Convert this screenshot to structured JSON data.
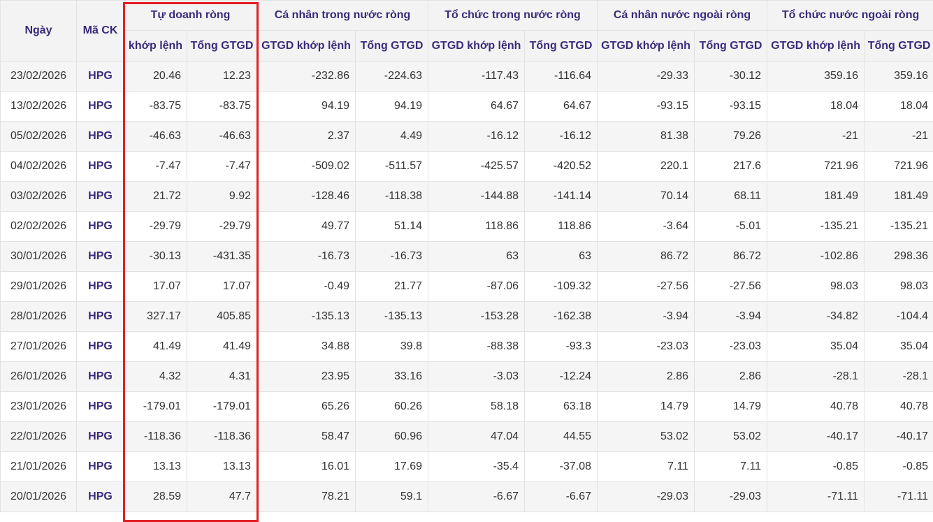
{
  "table": {
    "headers": {
      "date": "Ngày",
      "ticker": "Mã CK",
      "groups": [
        "Tự doanh ròng",
        "Cá nhân trong nước ròng",
        "Tổ chức trong nước ròng",
        "Cá nhân nước ngoài ròng",
        "Tổ chức nước ngoài ròng"
      ],
      "sub_first": [
        "khớp lệnh",
        "Tổng GTGD"
      ],
      "sub_other": [
        "GTGD khớp lệnh",
        "Tổng GTGD"
      ]
    },
    "rows": [
      {
        "date": "23/02/2026",
        "ticker": "HPG",
        "values": [
          "20.46",
          "12.23",
          "-232.86",
          "-224.63",
          "-117.43",
          "-116.64",
          "-29.33",
          "-30.12",
          "359.16",
          "359.16"
        ]
      },
      {
        "date": "13/02/2026",
        "ticker": "HPG",
        "values": [
          "-83.75",
          "-83.75",
          "94.19",
          "94.19",
          "64.67",
          "64.67",
          "-93.15",
          "-93.15",
          "18.04",
          "18.04"
        ]
      },
      {
        "date": "05/02/2026",
        "ticker": "HPG",
        "values": [
          "-46.63",
          "-46.63",
          "2.37",
          "4.49",
          "-16.12",
          "-16.12",
          "81.38",
          "79.26",
          "-21",
          "-21"
        ]
      },
      {
        "date": "04/02/2026",
        "ticker": "HPG",
        "values": [
          "-7.47",
          "-7.47",
          "-509.02",
          "-511.57",
          "-425.57",
          "-420.52",
          "220.1",
          "217.6",
          "721.96",
          "721.96"
        ]
      },
      {
        "date": "03/02/2026",
        "ticker": "HPG",
        "values": [
          "21.72",
          "9.92",
          "-128.46",
          "-118.38",
          "-144.88",
          "-141.14",
          "70.14",
          "68.11",
          "181.49",
          "181.49"
        ]
      },
      {
        "date": "02/02/2026",
        "ticker": "HPG",
        "values": [
          "-29.79",
          "-29.79",
          "49.77",
          "51.14",
          "118.86",
          "118.86",
          "-3.64",
          "-5.01",
          "-135.21",
          "-135.21"
        ]
      },
      {
        "date": "30/01/2026",
        "ticker": "HPG",
        "values": [
          "-30.13",
          "-431.35",
          "-16.73",
          "-16.73",
          "63",
          "63",
          "86.72",
          "86.72",
          "-102.86",
          "298.36"
        ]
      },
      {
        "date": "29/01/2026",
        "ticker": "HPG",
        "values": [
          "17.07",
          "17.07",
          "-0.49",
          "21.77",
          "-87.06",
          "-109.32",
          "-27.56",
          "-27.56",
          "98.03",
          "98.03"
        ]
      },
      {
        "date": "28/01/2026",
        "ticker": "HPG",
        "values": [
          "327.17",
          "405.85",
          "-135.13",
          "-135.13",
          "-153.28",
          "-162.38",
          "-3.94",
          "-3.94",
          "-34.82",
          "-104.4"
        ]
      },
      {
        "date": "27/01/2026",
        "ticker": "HPG",
        "values": [
          "41.49",
          "41.49",
          "34.88",
          "39.8",
          "-88.38",
          "-93.3",
          "-23.03",
          "-23.03",
          "35.04",
          "35.04"
        ]
      },
      {
        "date": "26/01/2026",
        "ticker": "HPG",
        "values": [
          "4.32",
          "4.31",
          "23.95",
          "33.16",
          "-3.03",
          "-12.24",
          "2.86",
          "2.86",
          "-28.1",
          "-28.1"
        ]
      },
      {
        "date": "23/01/2026",
        "ticker": "HPG",
        "values": [
          "-179.01",
          "-179.01",
          "65.26",
          "60.26",
          "58.18",
          "63.18",
          "14.79",
          "14.79",
          "40.78",
          "40.78"
        ]
      },
      {
        "date": "22/01/2026",
        "ticker": "HPG",
        "values": [
          "-118.36",
          "-118.36",
          "58.47",
          "60.96",
          "47.04",
          "44.55",
          "53.02",
          "53.02",
          "-40.17",
          "-40.17"
        ]
      },
      {
        "date": "21/01/2026",
        "ticker": "HPG",
        "values": [
          "13.13",
          "13.13",
          "16.01",
          "17.69",
          "-35.4",
          "-37.08",
          "7.11",
          "7.11",
          "-0.85",
          "-0.85"
        ]
      },
      {
        "date": "20/01/2026",
        "ticker": "HPG",
        "values": [
          "28.59",
          "47.7",
          "78.21",
          "59.1",
          "-6.67",
          "-6.67",
          "-29.03",
          "-29.03",
          "-71.11",
          "-71.11"
        ]
      }
    ]
  },
  "colors": {
    "header_text": "#3b2a7a",
    "ticker_text": "#3b2a7a",
    "highlight_border": "#e31e24",
    "row_alt_bg": "#f5f5f5",
    "header_bg": "#f3f3f3"
  }
}
